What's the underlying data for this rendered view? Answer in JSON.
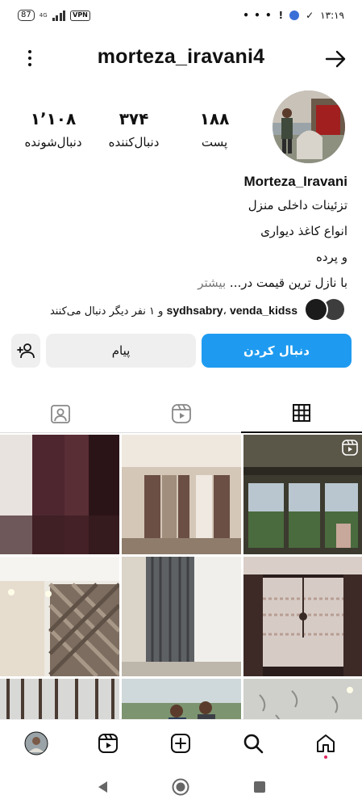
{
  "status_bar": {
    "battery": "87",
    "network": "4G",
    "vpn": "VPN",
    "dots": "• • •",
    "alert": "!",
    "time": "۱۳:۱۹"
  },
  "header": {
    "username": "morteza_iravani4"
  },
  "stats": {
    "posts_count": "۱۸۸",
    "posts_label": "پست",
    "followers_count": "۳۷۴",
    "followers_label": "دنبال‌کننده",
    "following_count": "۱٬۱۰۸",
    "following_label": "دنبال‌شونده"
  },
  "bio": {
    "name": "Morteza_Iravani",
    "line1": "تزئینات داخلی منزل",
    "line2": "انواع کاغذ دیواری",
    "line3": "و پرده",
    "line4": "با نازل ترین قیمت در...",
    "more": "بیشتر"
  },
  "mutual": {
    "user1": "sydhsabry",
    "separator": "،",
    "user2": "venda_kidss",
    "suffix": "و ۱ نفر دیگر دنبال می‌کنند"
  },
  "buttons": {
    "follow": "دنبال کردن",
    "message": "پیام"
  },
  "tabs": [
    "grid",
    "reels",
    "tagged"
  ],
  "colors": {
    "accent": "#1e9bf0",
    "secondary_button": "#efefef",
    "notification_dot": "#e0245e"
  },
  "bottom_nav": [
    "home-icon",
    "search-icon",
    "create-icon",
    "reels-icon",
    "profile-avatar"
  ],
  "system_nav": [
    "back-icon",
    "home-circle-icon",
    "recents-icon"
  ]
}
